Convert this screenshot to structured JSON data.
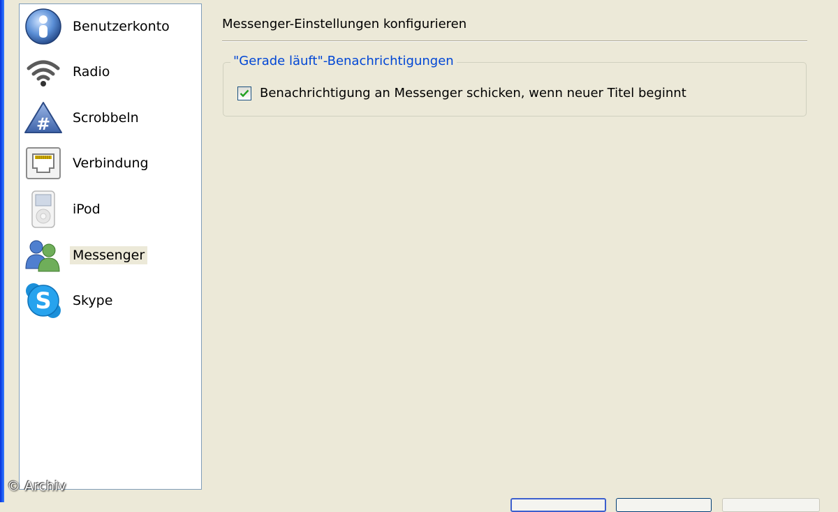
{
  "sidebar": {
    "items": [
      {
        "label": "Benutzerkonto",
        "icon": "user-account-icon",
        "selected": false
      },
      {
        "label": "Radio",
        "icon": "wifi-radio-icon",
        "selected": false
      },
      {
        "label": "Scrobbeln",
        "icon": "scrobble-hash-icon",
        "selected": false
      },
      {
        "label": "Verbindung",
        "icon": "network-port-icon",
        "selected": false
      },
      {
        "label": "iPod",
        "icon": "ipod-icon",
        "selected": false
      },
      {
        "label": "Messenger",
        "icon": "messenger-users-icon",
        "selected": true
      },
      {
        "label": "Skype",
        "icon": "skype-icon",
        "selected": false
      }
    ]
  },
  "main": {
    "title": "Messenger-Einstellungen konfigurieren",
    "group": {
      "legend": "\"Gerade läuft\"-Benachrichtigungen",
      "checkbox_label": "Benachrichtigung an Messenger schicken, wenn neuer Titel beginnt",
      "checked": true
    }
  },
  "watermark": "© Archiv",
  "colors": {
    "accent_blue": "#0046d5",
    "dialog_bg": "#ece9d8",
    "selection_bg": "#ece9d8"
  }
}
